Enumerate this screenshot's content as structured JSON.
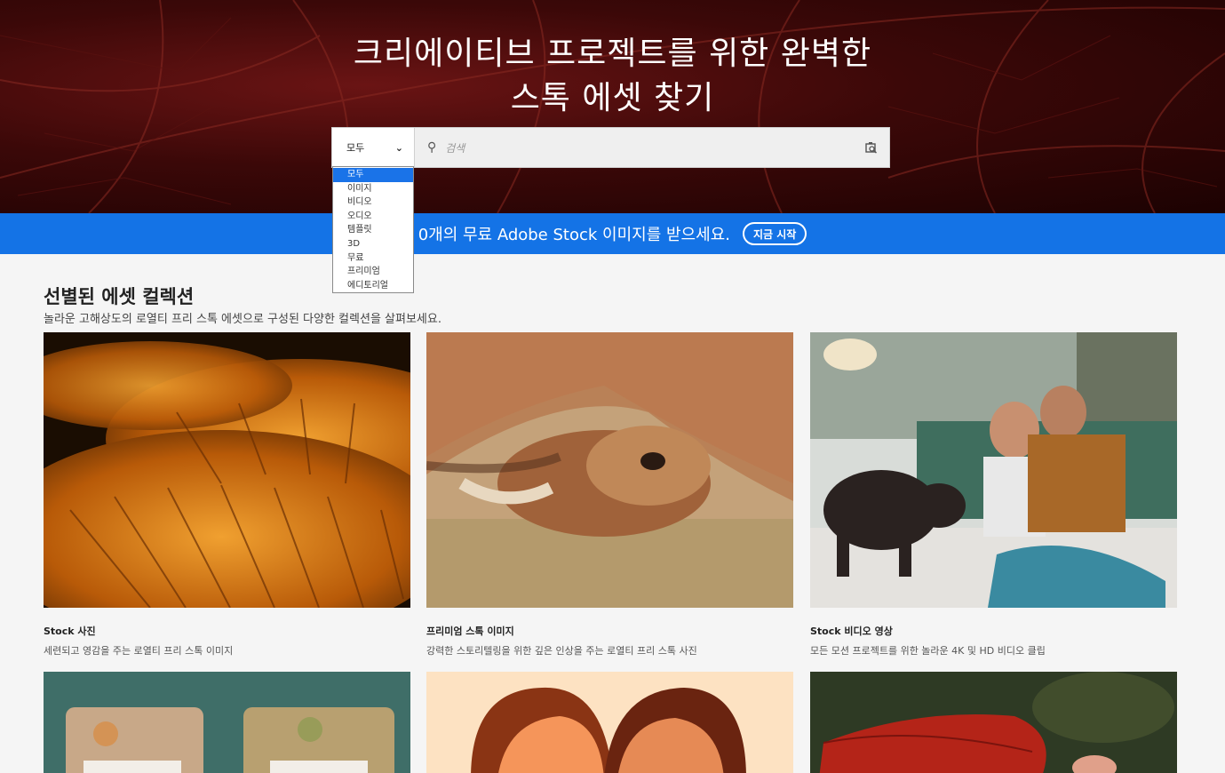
{
  "hero": {
    "title_line1": "크리에이티브 프로젝트를 위한 완벽한",
    "title_line2": "스톡 에셋 찾기"
  },
  "search": {
    "category_selected": "모두",
    "placeholder": "검색",
    "visual_search_icon": "camera-search-icon"
  },
  "dropdown": {
    "options": [
      "모두",
      "이미지",
      "비디오",
      "오디오",
      "템플릿",
      "3D",
      "무료",
      "프리미엄",
      "에디토리얼"
    ],
    "selected_index": 0
  },
  "promo": {
    "text": "0개의 무료 Adobe Stock 이미지를 받으세요.",
    "button_label": "지금 시작",
    "color": "#1473e6"
  },
  "collection": {
    "title": "선별된 에셋 컬렉션",
    "subtitle": "놀라운 고해상도의 로열티 프리 스톡 에셋으로 구성된 다양한 컬렉션을 살펴보세요.",
    "cards": [
      {
        "title": "Stock 사진",
        "desc": "세련되고 영감을 주는 로열티 프리 스톡 이미지"
      },
      {
        "title": "프리미엄 스톡 이미지",
        "desc": "강력한 스토리텔링을 위한 깊은 인상을 주는 로열티 프리 스톡 사진"
      },
      {
        "title": "Stock 비디오 영상",
        "desc": "모든 모션 프로젝트를 위한 놀라운 4K 및 HD 비디오 클립"
      }
    ]
  }
}
